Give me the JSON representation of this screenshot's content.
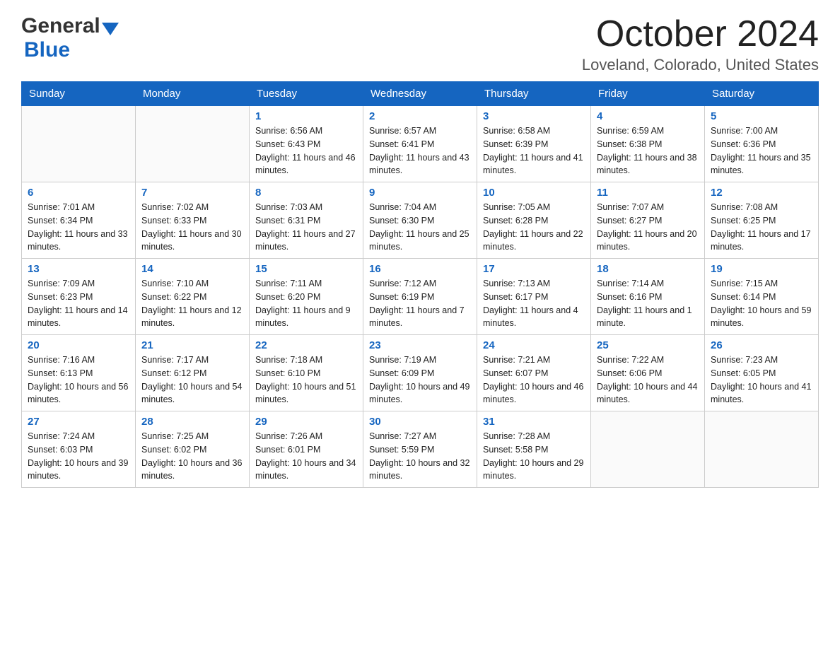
{
  "header": {
    "logo": {
      "general": "General",
      "blue": "Blue"
    },
    "title": "October 2024",
    "location": "Loveland, Colorado, United States"
  },
  "weekdays": [
    "Sunday",
    "Monday",
    "Tuesday",
    "Wednesday",
    "Thursday",
    "Friday",
    "Saturday"
  ],
  "weeks": [
    [
      {
        "day": "",
        "sunrise": "",
        "sunset": "",
        "daylight": ""
      },
      {
        "day": "",
        "sunrise": "",
        "sunset": "",
        "daylight": ""
      },
      {
        "day": "1",
        "sunrise": "Sunrise: 6:56 AM",
        "sunset": "Sunset: 6:43 PM",
        "daylight": "Daylight: 11 hours and 46 minutes."
      },
      {
        "day": "2",
        "sunrise": "Sunrise: 6:57 AM",
        "sunset": "Sunset: 6:41 PM",
        "daylight": "Daylight: 11 hours and 43 minutes."
      },
      {
        "day": "3",
        "sunrise": "Sunrise: 6:58 AM",
        "sunset": "Sunset: 6:39 PM",
        "daylight": "Daylight: 11 hours and 41 minutes."
      },
      {
        "day": "4",
        "sunrise": "Sunrise: 6:59 AM",
        "sunset": "Sunset: 6:38 PM",
        "daylight": "Daylight: 11 hours and 38 minutes."
      },
      {
        "day": "5",
        "sunrise": "Sunrise: 7:00 AM",
        "sunset": "Sunset: 6:36 PM",
        "daylight": "Daylight: 11 hours and 35 minutes."
      }
    ],
    [
      {
        "day": "6",
        "sunrise": "Sunrise: 7:01 AM",
        "sunset": "Sunset: 6:34 PM",
        "daylight": "Daylight: 11 hours and 33 minutes."
      },
      {
        "day": "7",
        "sunrise": "Sunrise: 7:02 AM",
        "sunset": "Sunset: 6:33 PM",
        "daylight": "Daylight: 11 hours and 30 minutes."
      },
      {
        "day": "8",
        "sunrise": "Sunrise: 7:03 AM",
        "sunset": "Sunset: 6:31 PM",
        "daylight": "Daylight: 11 hours and 27 minutes."
      },
      {
        "day": "9",
        "sunrise": "Sunrise: 7:04 AM",
        "sunset": "Sunset: 6:30 PM",
        "daylight": "Daylight: 11 hours and 25 minutes."
      },
      {
        "day": "10",
        "sunrise": "Sunrise: 7:05 AM",
        "sunset": "Sunset: 6:28 PM",
        "daylight": "Daylight: 11 hours and 22 minutes."
      },
      {
        "day": "11",
        "sunrise": "Sunrise: 7:07 AM",
        "sunset": "Sunset: 6:27 PM",
        "daylight": "Daylight: 11 hours and 20 minutes."
      },
      {
        "day": "12",
        "sunrise": "Sunrise: 7:08 AM",
        "sunset": "Sunset: 6:25 PM",
        "daylight": "Daylight: 11 hours and 17 minutes."
      }
    ],
    [
      {
        "day": "13",
        "sunrise": "Sunrise: 7:09 AM",
        "sunset": "Sunset: 6:23 PM",
        "daylight": "Daylight: 11 hours and 14 minutes."
      },
      {
        "day": "14",
        "sunrise": "Sunrise: 7:10 AM",
        "sunset": "Sunset: 6:22 PM",
        "daylight": "Daylight: 11 hours and 12 minutes."
      },
      {
        "day": "15",
        "sunrise": "Sunrise: 7:11 AM",
        "sunset": "Sunset: 6:20 PM",
        "daylight": "Daylight: 11 hours and 9 minutes."
      },
      {
        "day": "16",
        "sunrise": "Sunrise: 7:12 AM",
        "sunset": "Sunset: 6:19 PM",
        "daylight": "Daylight: 11 hours and 7 minutes."
      },
      {
        "day": "17",
        "sunrise": "Sunrise: 7:13 AM",
        "sunset": "Sunset: 6:17 PM",
        "daylight": "Daylight: 11 hours and 4 minutes."
      },
      {
        "day": "18",
        "sunrise": "Sunrise: 7:14 AM",
        "sunset": "Sunset: 6:16 PM",
        "daylight": "Daylight: 11 hours and 1 minute."
      },
      {
        "day": "19",
        "sunrise": "Sunrise: 7:15 AM",
        "sunset": "Sunset: 6:14 PM",
        "daylight": "Daylight: 10 hours and 59 minutes."
      }
    ],
    [
      {
        "day": "20",
        "sunrise": "Sunrise: 7:16 AM",
        "sunset": "Sunset: 6:13 PM",
        "daylight": "Daylight: 10 hours and 56 minutes."
      },
      {
        "day": "21",
        "sunrise": "Sunrise: 7:17 AM",
        "sunset": "Sunset: 6:12 PM",
        "daylight": "Daylight: 10 hours and 54 minutes."
      },
      {
        "day": "22",
        "sunrise": "Sunrise: 7:18 AM",
        "sunset": "Sunset: 6:10 PM",
        "daylight": "Daylight: 10 hours and 51 minutes."
      },
      {
        "day": "23",
        "sunrise": "Sunrise: 7:19 AM",
        "sunset": "Sunset: 6:09 PM",
        "daylight": "Daylight: 10 hours and 49 minutes."
      },
      {
        "day": "24",
        "sunrise": "Sunrise: 7:21 AM",
        "sunset": "Sunset: 6:07 PM",
        "daylight": "Daylight: 10 hours and 46 minutes."
      },
      {
        "day": "25",
        "sunrise": "Sunrise: 7:22 AM",
        "sunset": "Sunset: 6:06 PM",
        "daylight": "Daylight: 10 hours and 44 minutes."
      },
      {
        "day": "26",
        "sunrise": "Sunrise: 7:23 AM",
        "sunset": "Sunset: 6:05 PM",
        "daylight": "Daylight: 10 hours and 41 minutes."
      }
    ],
    [
      {
        "day": "27",
        "sunrise": "Sunrise: 7:24 AM",
        "sunset": "Sunset: 6:03 PM",
        "daylight": "Daylight: 10 hours and 39 minutes."
      },
      {
        "day": "28",
        "sunrise": "Sunrise: 7:25 AM",
        "sunset": "Sunset: 6:02 PM",
        "daylight": "Daylight: 10 hours and 36 minutes."
      },
      {
        "day": "29",
        "sunrise": "Sunrise: 7:26 AM",
        "sunset": "Sunset: 6:01 PM",
        "daylight": "Daylight: 10 hours and 34 minutes."
      },
      {
        "day": "30",
        "sunrise": "Sunrise: 7:27 AM",
        "sunset": "Sunset: 5:59 PM",
        "daylight": "Daylight: 10 hours and 32 minutes."
      },
      {
        "day": "31",
        "sunrise": "Sunrise: 7:28 AM",
        "sunset": "Sunset: 5:58 PM",
        "daylight": "Daylight: 10 hours and 29 minutes."
      },
      {
        "day": "",
        "sunrise": "",
        "sunset": "",
        "daylight": ""
      },
      {
        "day": "",
        "sunrise": "",
        "sunset": "",
        "daylight": ""
      }
    ]
  ]
}
